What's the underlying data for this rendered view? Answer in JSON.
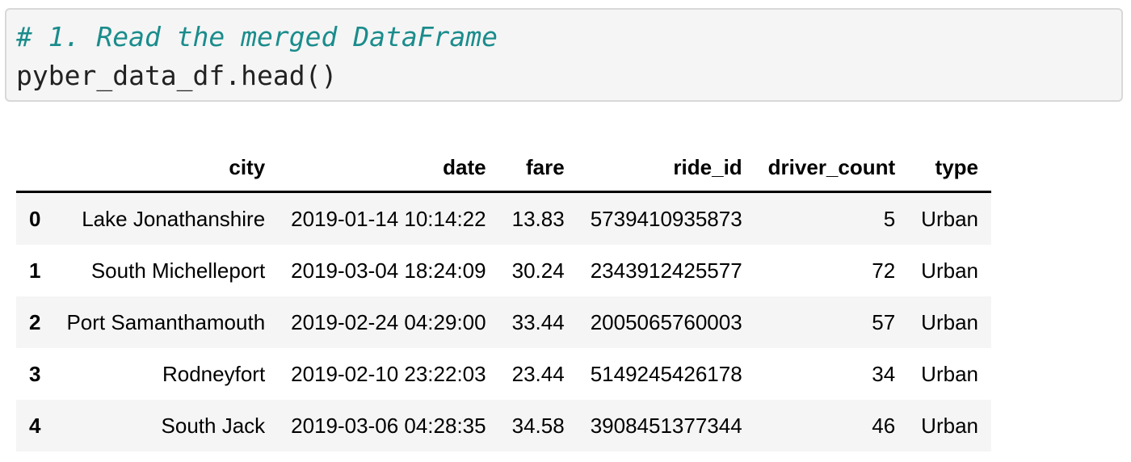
{
  "cell": {
    "comment": "# 1. Read the merged DataFrame",
    "code": "pyber_data_df.head()"
  },
  "table": {
    "index_header": "",
    "columns": [
      "city",
      "date",
      "fare",
      "ride_id",
      "driver_count",
      "type"
    ],
    "rows": [
      {
        "index": "0",
        "cells": [
          "Lake Jonathanshire",
          "2019-01-14 10:14:22",
          "13.83",
          "5739410935873",
          "5",
          "Urban"
        ]
      },
      {
        "index": "1",
        "cells": [
          "South Michelleport",
          "2019-03-04 18:24:09",
          "30.24",
          "2343912425577",
          "72",
          "Urban"
        ]
      },
      {
        "index": "2",
        "cells": [
          "Port Samanthamouth",
          "2019-02-24 04:29:00",
          "33.44",
          "2005065760003",
          "57",
          "Urban"
        ]
      },
      {
        "index": "3",
        "cells": [
          "Rodneyfort",
          "2019-02-10 23:22:03",
          "23.44",
          "5149245426178",
          "34",
          "Urban"
        ]
      },
      {
        "index": "4",
        "cells": [
          "South Jack",
          "2019-03-06 04:28:35",
          "34.58",
          "3908451377344",
          "46",
          "Urban"
        ]
      }
    ]
  }
}
